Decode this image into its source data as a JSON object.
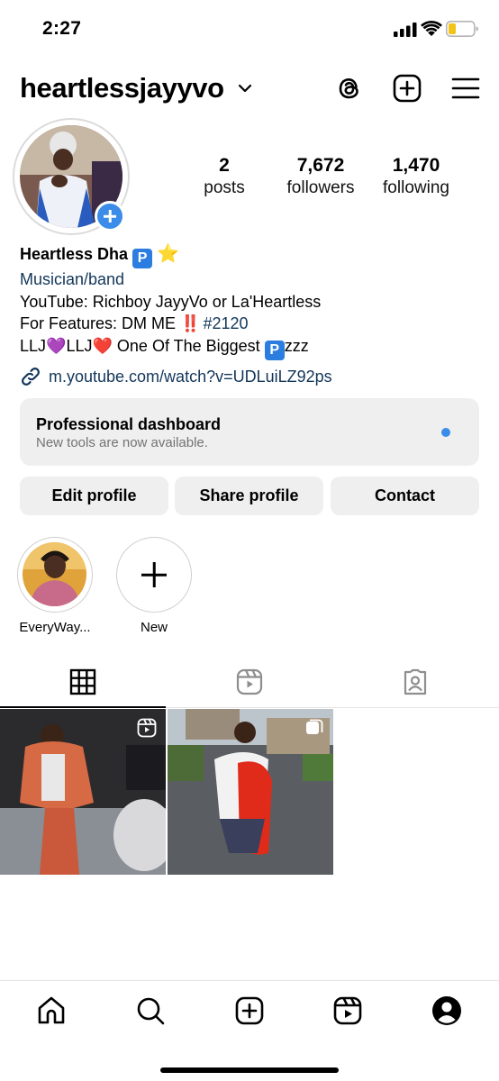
{
  "status_bar": {
    "time": "2:27"
  },
  "header": {
    "username": "heartlessjayyvo",
    "icons": [
      "threads-icon",
      "create-post-icon",
      "menu-icon"
    ]
  },
  "profile": {
    "stats": [
      {
        "value": "2",
        "label": "posts"
      },
      {
        "value": "7,672",
        "label": "followers"
      },
      {
        "value": "1,470",
        "label": "following"
      }
    ],
    "name": "Heartless Dha",
    "category": "Musician/band",
    "bio_line_1": "YouTube: Richboy JayyVo or La'Heartless",
    "bio_line_2_prefix": "For Features: DM ME",
    "bio_line_2_bang": "‼️",
    "bio_line_2_hashtag": "#2120",
    "bio_line_3_a": "LLJ",
    "bio_line_3_b": "LLJ",
    "bio_line_3_c": "One Of The Biggest",
    "bio_line_3_d": "zzz",
    "emoji_p": "P",
    "emoji_star": "⭐",
    "emoji_heart_purple": "💜",
    "emoji_heart_red": "❤️",
    "link": "m.youtube.com/watch?v=UDLuiLZ92ps"
  },
  "dashboard": {
    "title": "Professional dashboard",
    "subtitle": "New tools are now available.",
    "accent": "#3b8ce8"
  },
  "buttons": {
    "edit": "Edit profile",
    "share": "Share profile",
    "contact": "Contact"
  },
  "highlights": [
    {
      "label": "EveryWay..."
    },
    {
      "label": "New"
    }
  ],
  "tabs": [
    "grid-icon",
    "reels-icon",
    "tagged-icon"
  ],
  "bottom_nav": [
    "home-icon",
    "search-icon",
    "create-icon",
    "reels-icon",
    "profile-icon"
  ]
}
